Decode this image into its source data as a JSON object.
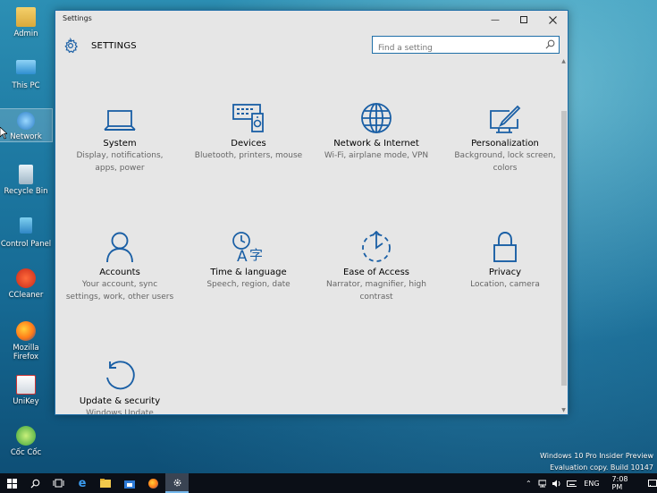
{
  "desktop": {
    "icons": [
      {
        "label": "Admin"
      },
      {
        "label": "This PC"
      },
      {
        "label": "Network"
      },
      {
        "label": "Recycle Bin"
      },
      {
        "label": "Control Panel"
      },
      {
        "label": "CCleaner"
      },
      {
        "label": "Mozilla Firefox"
      },
      {
        "label": "UniKey"
      },
      {
        "label": "Cốc Cốc"
      }
    ]
  },
  "window": {
    "title": "Settings",
    "header": "SETTINGS",
    "search_placeholder": "Find a setting"
  },
  "tiles": [
    {
      "name": "System",
      "desc": "Display, notifications, apps, power"
    },
    {
      "name": "Devices",
      "desc": "Bluetooth, printers, mouse"
    },
    {
      "name": "Network & Internet",
      "desc": "Wi-Fi, airplane mode, VPN"
    },
    {
      "name": "Personalization",
      "desc": "Background, lock screen, colors"
    },
    {
      "name": "Accounts",
      "desc": "Your account, sync settings, work, other users"
    },
    {
      "name": "Time & language",
      "desc": "Speech, region, date"
    },
    {
      "name": "Ease of Access",
      "desc": "Narrator, magnifier, high contrast"
    },
    {
      "name": "Privacy",
      "desc": "Location, camera"
    },
    {
      "name": "Update & security",
      "desc": "Windows Update"
    }
  ],
  "watermark": {
    "line1": "Windows 10 Pro Insider Preview",
    "line2": "Evaluation copy. Build 10147"
  },
  "taskbar": {
    "language": "ENG",
    "time": "7:08 PM"
  },
  "colors": {
    "accent": "#1f6fa8",
    "icon_blue": "#1a5fa5"
  }
}
